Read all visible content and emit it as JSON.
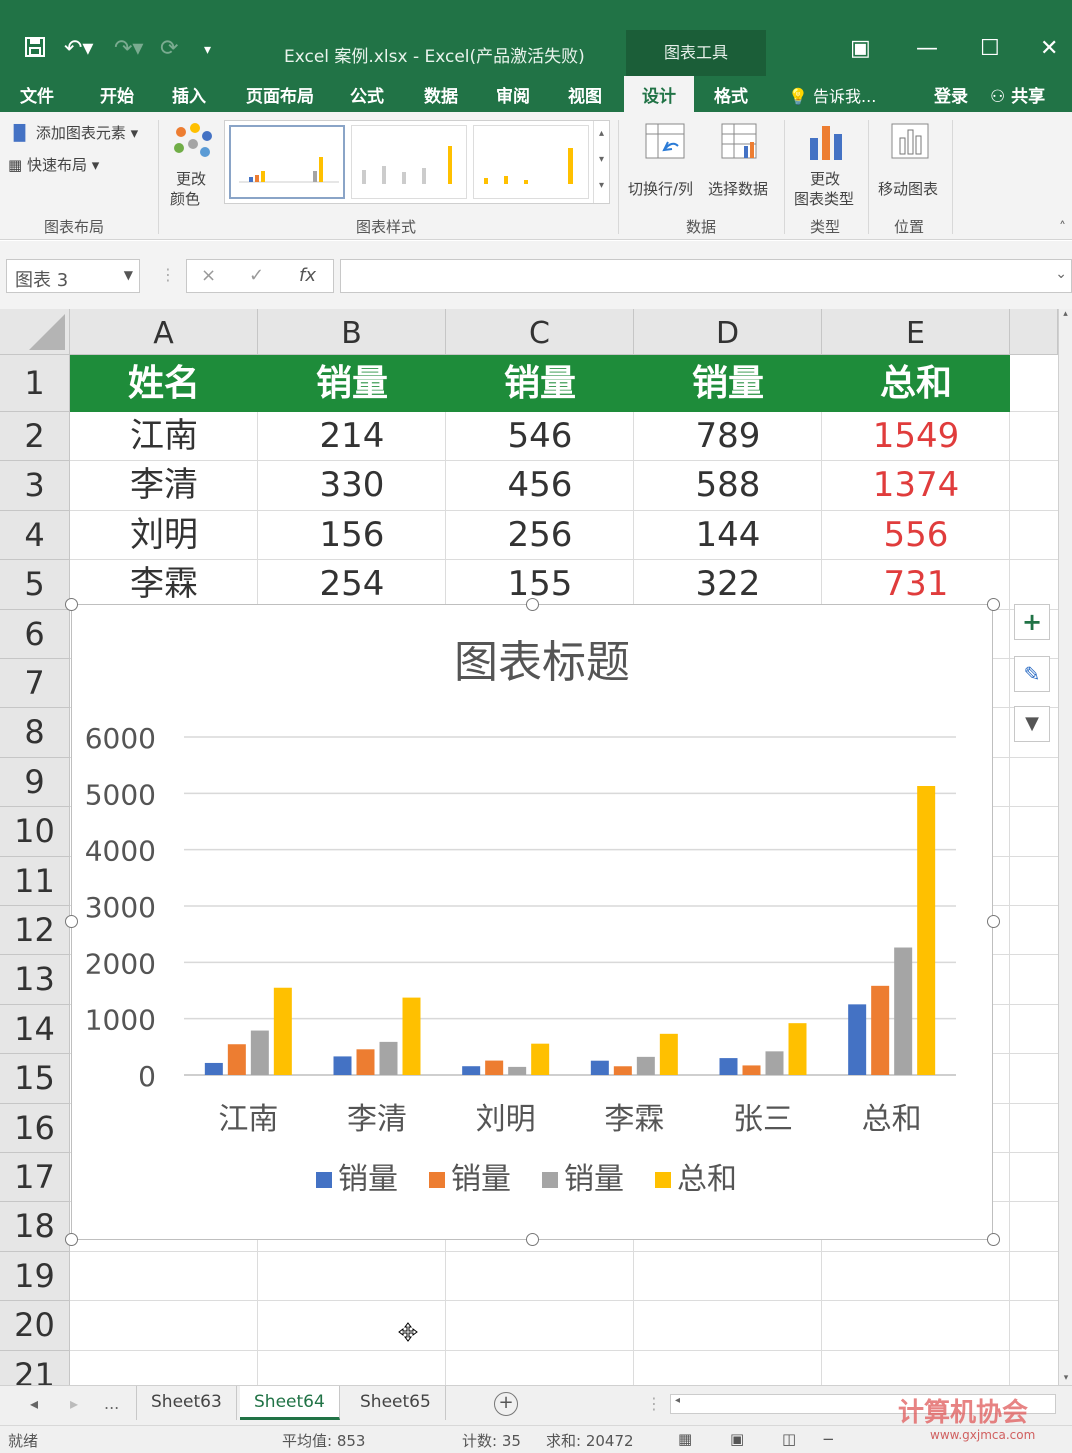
{
  "titlebar": {
    "title": "Excel 案例.xlsx - Excel(产品激活失败)",
    "chart_tools": "图表工具"
  },
  "menu": {
    "items": [
      "文件",
      "开始",
      "插入",
      "页面布局",
      "公式",
      "数据",
      "审阅",
      "视图",
      "设计",
      "格式"
    ],
    "tell": "告诉我...",
    "login": "登录",
    "share": "共享"
  },
  "ribbon": {
    "add_element": "添加图表元素",
    "quick_layout": "快速布局",
    "change_color_1": "更改",
    "change_color_2": "颜色",
    "switch_row_col": "切换行/列",
    "select_data": "选择数据",
    "change_type_1": "更改",
    "change_type_2": "图表类型",
    "move_chart": "移动图表",
    "groups": [
      "图表布局",
      "图表样式",
      "数据",
      "类型",
      "位置"
    ]
  },
  "formula_bar": {
    "name_box": "图表 3",
    "cancel": "×",
    "enter": "✓",
    "fx": "fx",
    "formula": ""
  },
  "sheet": {
    "columns": [
      "A",
      "B",
      "C",
      "D",
      "E"
    ],
    "rows": [
      "1",
      "2",
      "3",
      "4",
      "5",
      "6",
      "7",
      "8",
      "9",
      "10",
      "11",
      "12",
      "13",
      "14",
      "15",
      "16",
      "17",
      "18",
      "19",
      "20",
      "21"
    ],
    "header": [
      "姓名",
      "销量",
      "销量",
      "销量",
      "总和"
    ],
    "data": [
      [
        "江南",
        "214",
        "546",
        "789",
        "1549"
      ],
      [
        "李清",
        "330",
        "456",
        "588",
        "1374"
      ],
      [
        "刘明",
        "156",
        "256",
        "144",
        "556"
      ],
      [
        "李霖",
        "254",
        "155",
        "322",
        "731"
      ]
    ]
  },
  "chart_data": {
    "type": "bar",
    "title": "图表标题",
    "categories": [
      "江南",
      "李清",
      "刘明",
      "李霖",
      "张三",
      "总和"
    ],
    "series": [
      {
        "name": "销量",
        "color": "#4472C4",
        "values": [
          214,
          330,
          156,
          254,
          300,
          1254
        ]
      },
      {
        "name": "销量",
        "color": "#ED7D31",
        "values": [
          546,
          456,
          256,
          155,
          170,
          1583
        ]
      },
      {
        "name": "销量",
        "color": "#A5A5A5",
        "values": [
          789,
          588,
          144,
          322,
          420,
          2263
        ]
      },
      {
        "name": "总和",
        "color": "#FFC000",
        "values": [
          1549,
          1374,
          556,
          731,
          920,
          5130
        ]
      }
    ],
    "ylim": [
      0,
      6000
    ],
    "yticks": [
      "0",
      "1000",
      "2000",
      "3000",
      "4000",
      "5000",
      "6000"
    ],
    "grid": true,
    "legend": "bottom"
  },
  "chart_buttons": [
    "+",
    "✎",
    "▼"
  ],
  "tabs": {
    "ellipsis": "...",
    "sheets": [
      "Sheet63",
      "Sheet64",
      "Sheet65"
    ],
    "active": "Sheet64"
  },
  "status": {
    "ready": "就绪",
    "average": "平均值: 853",
    "count": "计数: 35",
    "sum": "求和: 20472"
  },
  "watermark": {
    "text": "计算机协会",
    "url": "www.gxjmca.com"
  },
  "colors": {
    "excel_green": "#217346",
    "header_fill": "#1E8C3A",
    "total_red": "#E03C3C"
  }
}
